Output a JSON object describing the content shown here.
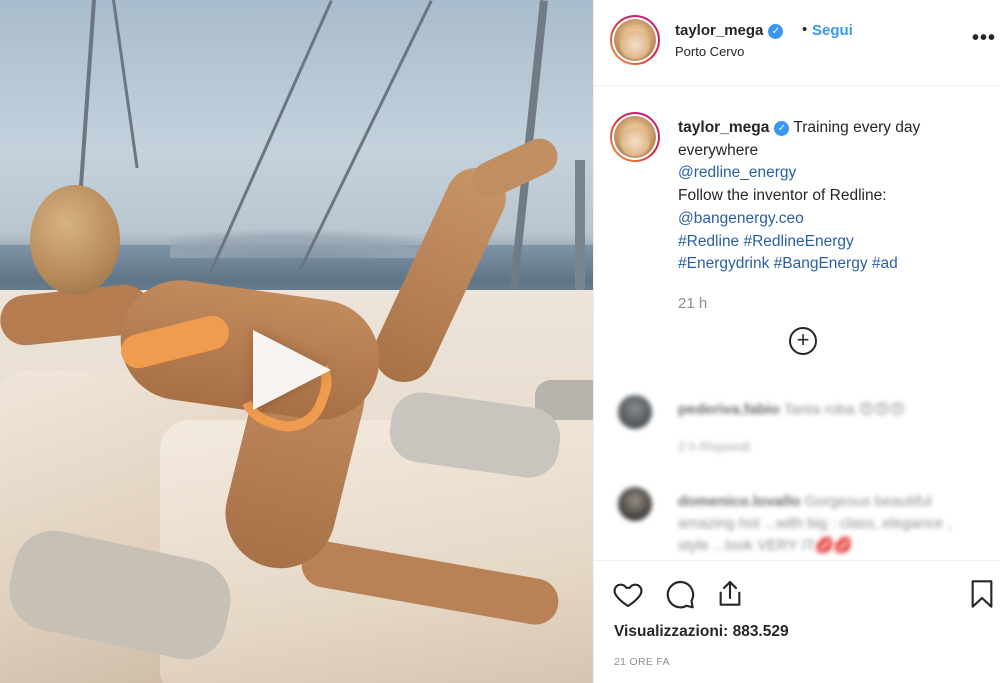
{
  "post": {
    "username": "taylor_mega",
    "follow_label": "Segui",
    "separator": "•",
    "location": "Porto Cervo",
    "more_label": "•••",
    "caption": {
      "username": "taylor_mega",
      "text": "Training every day everywhere",
      "mention1": "@redline_energy",
      "line2": "Follow the inventor of Redline:",
      "mention2": "@bangenergy.ceo",
      "hashtags_line1": "#Redline #RedlineEnergy",
      "hashtags_line2": "#Energydrink #BangEnergy #ad"
    },
    "time_ago": "21 h",
    "load_more_label": "+",
    "comments": [
      {
        "user": "pederiva.fabio",
        "text": "Tanta roba 😍😍😍",
        "meta": "2 h    Rispondi"
      },
      {
        "user": "domenico.lovallo",
        "text": "Gorgeous beautiful amazing hot ...with big : class, elegance , style ...look VERY IT💋💋",
        "meta": ""
      }
    ],
    "views_label": "Visualizzazioni: 883.529",
    "timestamp": "21 ORE FA"
  },
  "icons": [
    "heart-icon",
    "comment-icon",
    "share-icon",
    "bookmark-icon",
    "play-icon",
    "verified-icon",
    "more-options-icon",
    "load-more-icon"
  ],
  "colors": {
    "accent": "#3897f0",
    "text": "#262626",
    "muted": "#8e8e8e",
    "link": "#2a5fa5",
    "bikini": "#ef9c4e"
  }
}
